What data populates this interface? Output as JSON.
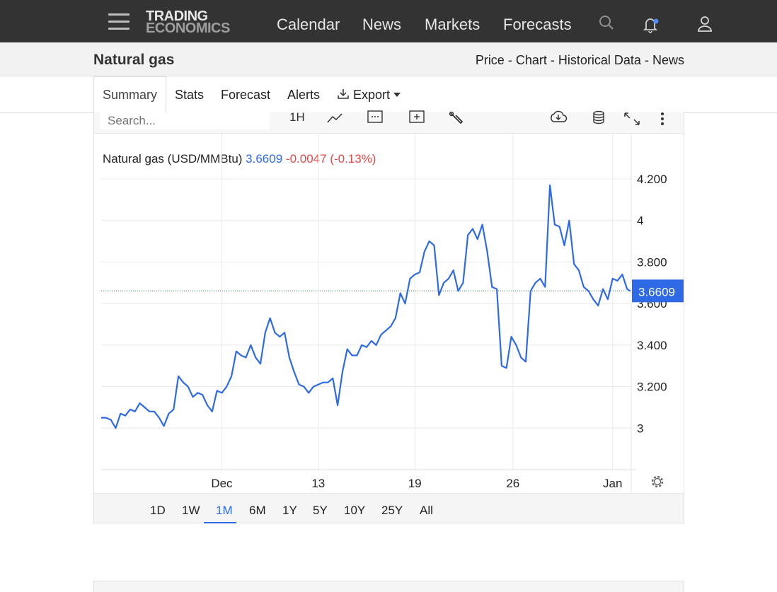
{
  "nav": {
    "logo_line1": "TRADING",
    "logo_line2": "ECONOMICS",
    "links": [
      "Calendar",
      "News",
      "Markets",
      "Forecasts"
    ],
    "icons": [
      "search-icon",
      "bell-icon",
      "user-icon"
    ],
    "notification_dot_color": "#4a8cf7"
  },
  "subheader": {
    "title": "Natural gas",
    "crumbs": [
      "Price",
      "Chart",
      "Historical Data",
      "News"
    ],
    "separator": "-"
  },
  "tabs": {
    "items": [
      "Summary",
      "Stats",
      "Forecast",
      "Alerts",
      "Export"
    ],
    "active": "Summary"
  },
  "toolbar": {
    "search_placeholder": "Search...",
    "interval_label": "1H",
    "icons": [
      "line-type-icon",
      "calendar-icon",
      "compare-add-icon",
      "indicator-wrench-icon",
      "download-cloud-icon",
      "database-icon",
      "fullscreen-icon",
      "more-vertical-icon"
    ]
  },
  "legend": {
    "name": "Natural gas (USD/MMBtu)",
    "price": "3.6609",
    "change": "-0.0047 (-0.13%)"
  },
  "ranges": {
    "items": [
      "1D",
      "1W",
      "1M",
      "6M",
      "1Y",
      "5Y",
      "10Y",
      "25Y",
      "All"
    ],
    "active": "1M"
  },
  "colors": {
    "line": "#2f6ae6",
    "negative": "#e34848",
    "last_price_tag": "#2f6ae6"
  },
  "chart_data": {
    "type": "line",
    "title": "Natural gas (USD/MMBtu)",
    "x_tick_labels": [
      "Dec",
      "13",
      "19",
      "26",
      "Jan"
    ],
    "x_tick_positions": [
      7.5,
      13.5,
      19.5,
      25.6,
      31.8
    ],
    "y_tick_labels": [
      "3",
      "3.200",
      "3.400",
      "3.600",
      "3.800",
      "4",
      "4.200"
    ],
    "y_ticks": [
      3.0,
      3.2,
      3.4,
      3.6,
      3.8,
      4.0,
      4.2
    ],
    "ylim": [
      2.8,
      4.35
    ],
    "xlim": [
      0,
      33.0
    ],
    "last_value_label": "3.6609",
    "last_value": 3.6609,
    "grid": true,
    "series": [
      {
        "name": "Natural gas",
        "x": [
          0.0,
          0.3,
          0.6,
          0.9,
          1.2,
          1.5,
          1.8,
          2.1,
          2.4,
          2.7,
          3.0,
          3.3,
          3.6,
          3.9,
          4.2,
          4.5,
          4.8,
          5.1,
          5.4,
          5.7,
          6.0,
          6.3,
          6.6,
          6.9,
          7.2,
          7.5,
          7.8,
          8.1,
          8.4,
          8.7,
          9.0,
          9.3,
          9.6,
          9.9,
          10.2,
          10.5,
          10.8,
          11.1,
          11.4,
          11.7,
          12.0,
          12.3,
          12.6,
          12.9,
          13.2,
          13.5,
          13.8,
          14.1,
          14.4,
          14.7,
          15.0,
          15.3,
          15.6,
          15.9,
          16.2,
          16.5,
          16.8,
          17.1,
          17.4,
          17.7,
          18.0,
          18.3,
          18.6,
          18.9,
          19.2,
          19.5,
          19.8,
          20.1,
          20.4,
          20.7,
          21.0,
          21.3,
          21.6,
          21.9,
          22.2,
          22.5,
          22.8,
          23.1,
          23.4,
          23.7,
          24.0,
          24.3,
          24.6,
          24.9,
          25.2,
          25.5,
          25.8,
          26.1,
          26.4,
          26.7,
          27.0,
          27.3,
          27.6,
          27.9,
          28.2,
          28.5,
          28.8,
          29.1,
          29.4,
          29.7,
          30.0,
          30.3,
          30.6,
          30.9,
          31.2,
          31.5,
          31.8,
          32.1,
          32.4,
          32.7,
          32.9
        ],
        "y": [
          3.05,
          3.05,
          3.04,
          3.0,
          3.07,
          3.06,
          3.09,
          3.08,
          3.12,
          3.1,
          3.08,
          3.08,
          3.05,
          3.01,
          3.07,
          3.09,
          3.25,
          3.22,
          3.2,
          3.15,
          3.17,
          3.16,
          3.11,
          3.08,
          3.18,
          3.17,
          3.2,
          3.25,
          3.37,
          3.35,
          3.34,
          3.4,
          3.34,
          3.31,
          3.46,
          3.53,
          3.46,
          3.44,
          3.46,
          3.34,
          3.27,
          3.21,
          3.2,
          3.17,
          3.2,
          3.21,
          3.22,
          3.22,
          3.24,
          3.11,
          3.27,
          3.38,
          3.35,
          3.35,
          3.4,
          3.39,
          3.42,
          3.4,
          3.45,
          3.47,
          3.49,
          3.53,
          3.65,
          3.6,
          3.72,
          3.74,
          3.75,
          3.85,
          3.9,
          3.88,
          3.64,
          3.7,
          3.72,
          3.76,
          3.66,
          3.7,
          3.93,
          3.96,
          3.91,
          3.98,
          3.85,
          3.68,
          3.67,
          3.3,
          3.29,
          3.44,
          3.4,
          3.34,
          3.32,
          3.66,
          3.7,
          3.72,
          3.68,
          4.17,
          3.98,
          3.97,
          3.88,
          4.0,
          3.79,
          3.76,
          3.68,
          3.66,
          3.62,
          3.59,
          3.67,
          3.62,
          3.72,
          3.71,
          3.74,
          3.67,
          3.66
        ]
      }
    ]
  }
}
